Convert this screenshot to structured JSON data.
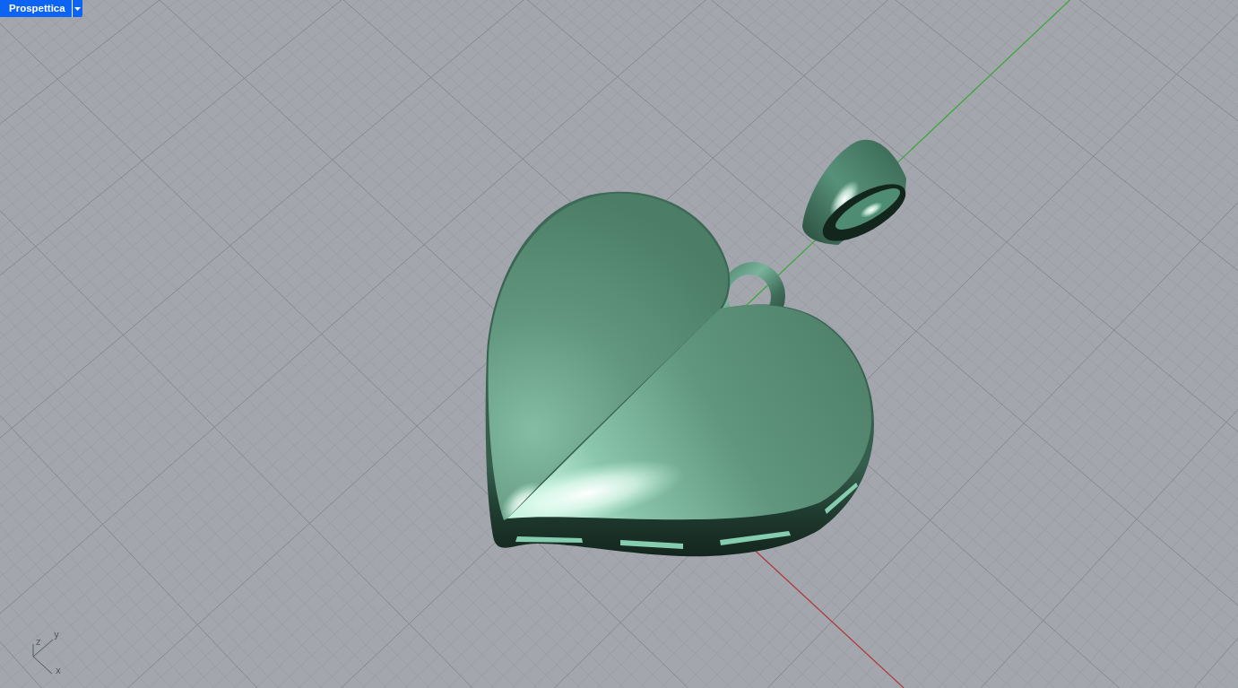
{
  "viewport": {
    "tab": {
      "label": "Prospettica",
      "selected": true
    }
  },
  "axis_triad": {
    "axes": [
      {
        "label": "z"
      },
      {
        "label": "y"
      },
      {
        "label": "x"
      }
    ]
  }
}
